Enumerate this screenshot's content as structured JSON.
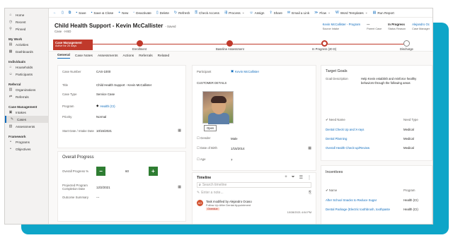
{
  "nav": {
    "items_top": [
      {
        "icon": "home-icon",
        "label": "Home"
      },
      {
        "icon": "clock-icon",
        "label": "Recent"
      },
      {
        "icon": "pin-icon",
        "label": "Pinned"
      }
    ],
    "my_work_header": "My Work",
    "my_work": [
      {
        "icon": "activity-icon",
        "label": "Activities"
      },
      {
        "icon": "dashboard-icon",
        "label": "Dashboards"
      }
    ],
    "individuals_header": "Individuals",
    "individuals": [
      {
        "icon": "household-icon",
        "label": "Households"
      },
      {
        "icon": "person-icon",
        "label": "Participants"
      }
    ],
    "referral_header": "Referral",
    "referral": [
      {
        "icon": "organization-icon",
        "label": "Organizations"
      },
      {
        "icon": "referral-icon",
        "label": "Referrals"
      }
    ],
    "case_header": "Case Management",
    "case": [
      {
        "icon": "intake-icon",
        "label": "Intakes"
      },
      {
        "icon": "case-icon",
        "label": "Cases"
      },
      {
        "icon": "assessment-icon",
        "label": "Assessments"
      }
    ],
    "framework_header": "Framework",
    "framework": [
      {
        "icon": "bullet-icon",
        "label": "Programs"
      },
      {
        "icon": "bullet-icon",
        "label": "Objectives"
      }
    ]
  },
  "cmdbar": {
    "items": [
      "Save",
      "Save & Close",
      "New",
      "Deactivate",
      "Delete",
      "Refresh",
      "Check Access",
      "Process",
      "Assign",
      "Share",
      "Email a Link",
      "Flow",
      "Word Templates",
      "Run Report"
    ]
  },
  "header": {
    "title": "Child Health Support - Kevin McCallister",
    "saved": "- Saved",
    "subtitle": "Case  ·  HSD",
    "f1_value": "Kevin McCallister - Program",
    "f1_label": "Source Intake",
    "f2_value": "---",
    "f2_label": "Parent Case",
    "f3_value": "In Progress",
    "f3_label": "Status Reason",
    "f4_value": "Alejandro Oc",
    "f4_label": "Case Manager"
  },
  "bpf": {
    "active_title": "Case Management",
    "active_sub": "Active for 20 days",
    "stages": [
      "Enrollment",
      "Baseline Assessment",
      "In Progress (20 D)",
      "Discharge"
    ]
  },
  "tabs": [
    "General",
    "Case Notes",
    "Assessments",
    "Actions",
    "Referrals",
    "Related"
  ],
  "case_fields": {
    "case_number_label": "Case Number",
    "case_number": "CAS-1000",
    "title_label": "Title",
    "title": "Child Health Support - Kevin McCallister",
    "case_type_label": "Case Type",
    "case_type": "Service Case",
    "program_label": "Program",
    "program": "Health (CI)",
    "priority_label": "Priority",
    "priority": "Normal",
    "start_label": "Start Date / Intake Date",
    "start": "10/15/2021"
  },
  "progress": {
    "header": "Overall Progress",
    "pct_label": "Overall Progress %",
    "pct_value": "60",
    "projected_label": "Projected Program Completion Date",
    "projected_value": "12/2/2021",
    "summary_label": "Outcome Summary",
    "summary_value": "---"
  },
  "participant": {
    "label": "Participant",
    "value": "Kevin McCallister",
    "details_header": "CUSTOMER DETAILS",
    "open": "Open",
    "gender_label": "Gender",
    "gender": "Male",
    "dob_label": "Date of Birth",
    "dob": "1/15/2014",
    "age_label": "Age",
    "age": "7"
  },
  "timeline": {
    "header": "Timeline",
    "search_placeholder": "Search timeline",
    "note_placeholder": "Enter a note...",
    "entry_title": "Task modified by Alejandro Ocaso",
    "entry_sub": "Follow Up After Dental Appointment",
    "entry_badge": "Overdue",
    "entry_date": "10/28/2021 4:04 PM",
    "avatar_initials": "AO"
  },
  "target_goals": {
    "header": "Target Goals",
    "desc_label": "Goal Description",
    "desc_value": "Help Kevin establish and reinforce healthy behaviors through the following areas",
    "col_name": "Need Name",
    "col_type": "Need Type",
    "rows": [
      {
        "name": "Dental Check Up and X-rays",
        "type": "Medical"
      },
      {
        "name": "Dental Planning",
        "type": "Medical"
      },
      {
        "name": "Overall Health Check-up/Review",
        "type": "Medical"
      }
    ]
  },
  "incentives": {
    "header": "Incentives",
    "col_name": "Name",
    "col_prog": "Program",
    "rows": [
      {
        "name": "After School Snacks to Reduce Sugar",
        "prog": "Health (CI)"
      },
      {
        "name": "Dental Package (Electric toothbrush, toothpaste",
        "prog": "Health (CI)"
      }
    ]
  }
}
